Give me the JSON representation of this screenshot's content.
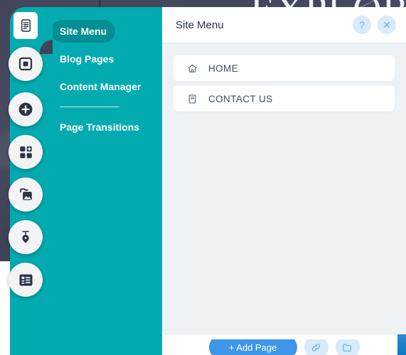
{
  "site_canvas": {
    "hero_title": "EXPLORE",
    "hero_glyph": "&"
  },
  "rail": {
    "items": [
      {
        "name": "pages-icon",
        "label": "Pages",
        "active": true
      },
      {
        "name": "sections-icon",
        "label": "Sections",
        "active": false
      },
      {
        "name": "add-icon",
        "label": "Add",
        "active": false
      },
      {
        "name": "apps-add-icon",
        "label": "Add Apps",
        "active": false
      },
      {
        "name": "media-icon",
        "label": "Media",
        "active": false
      },
      {
        "name": "pen-nib-icon",
        "label": "Design",
        "active": false
      },
      {
        "name": "list-icon",
        "label": "Content",
        "active": false
      }
    ]
  },
  "teal_menu": {
    "items": [
      {
        "label": "Site Menu",
        "selected": true
      },
      {
        "label": "Blog Pages",
        "selected": false
      },
      {
        "label": "Content Manager",
        "selected": false
      },
      {
        "label": "Page Transitions",
        "selected": false
      }
    ],
    "separator_after_index": 2
  },
  "panel": {
    "title": "Site Menu",
    "help_label": "?",
    "close_label": "✕",
    "pages": [
      {
        "label": "HOME",
        "icon": "home-icon"
      },
      {
        "label": "CONTACT US",
        "icon": "page-icon"
      }
    ]
  },
  "bottom_bar": {
    "add_page_label": "+ Add Page",
    "link_action_label": "Link",
    "folder_action_label": "Folder"
  },
  "colors": {
    "teal": "#02abb0",
    "teal_selected": "#038e93",
    "panel_bg": "#eff2f5",
    "accent_blue": "#3e97ea",
    "soft_blue": "#d7ebfa",
    "text_slate": "#3a5068"
  }
}
